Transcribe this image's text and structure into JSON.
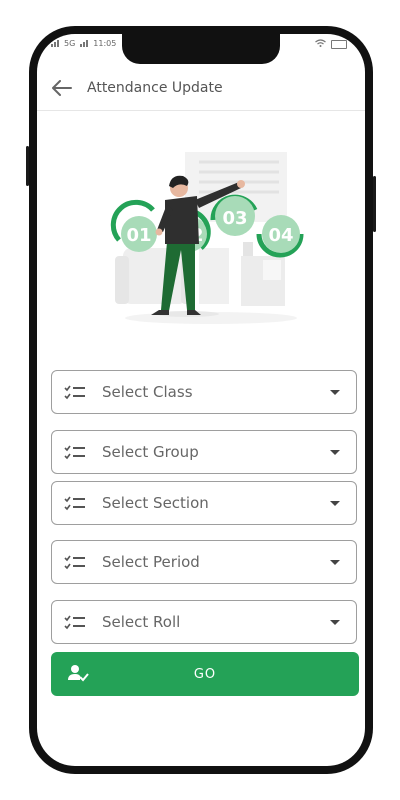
{
  "status_bar": {
    "time": "11:05",
    "network": "5G"
  },
  "header": {
    "title": "Attendance Update"
  },
  "illustration": {
    "steps": [
      "01",
      "02",
      "03",
      "04"
    ]
  },
  "form": {
    "fields": [
      {
        "label": "Select Class"
      },
      {
        "label": "Select Group"
      },
      {
        "label": "Select Section"
      },
      {
        "label": "Select Period"
      },
      {
        "label": "Select Roll"
      }
    ],
    "submit_label": "GO"
  },
  "colors": {
    "accent": "#24a257",
    "accent_light": "#a8dbb8",
    "text": "#555555",
    "border": "#9e9e9e"
  }
}
